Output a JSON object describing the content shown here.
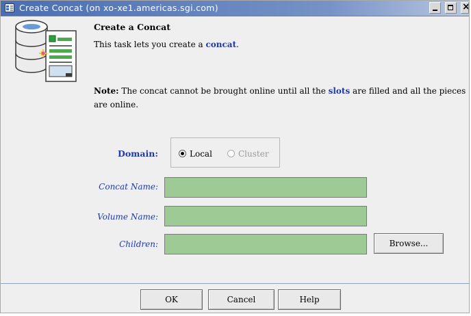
{
  "window": {
    "title": "Create Concat (on xo-xe1.americas.sgi.com)",
    "controls": {
      "minimize": "_",
      "maximize": "□",
      "close": "×"
    }
  },
  "intro": {
    "heading": "Create a Concat",
    "desc_prefix": "This task lets you create a ",
    "desc_link": "concat",
    "desc_suffix": ".",
    "note_label": "Note:",
    "note_text_1": " The concat cannot be brought online until all the ",
    "note_link": "slots",
    "note_text_2": " are filled and all the pieces",
    "note_text_3": "are online."
  },
  "form": {
    "domain_label": "Domain:",
    "domain_options": [
      {
        "label": "Local",
        "selected": true,
        "enabled": true
      },
      {
        "label": "Cluster",
        "selected": false,
        "enabled": false
      }
    ],
    "concat_name_label": "Concat Name:",
    "concat_name_value": "",
    "volume_name_label": "Volume Name:",
    "volume_name_value": "",
    "children_label": "Children:",
    "children_value": "",
    "browse_label": "Browse..."
  },
  "footer": {
    "ok_label": "OK",
    "cancel_label": "Cancel",
    "help_label": "Help"
  },
  "colors": {
    "title_gradient_start": "#4b6eb1",
    "link_blue": "#1d38b0",
    "field_green": "#9ecb95",
    "background": "#efefef"
  },
  "icons": {
    "title": "app-window-icon",
    "hero": "database-document-icon"
  }
}
